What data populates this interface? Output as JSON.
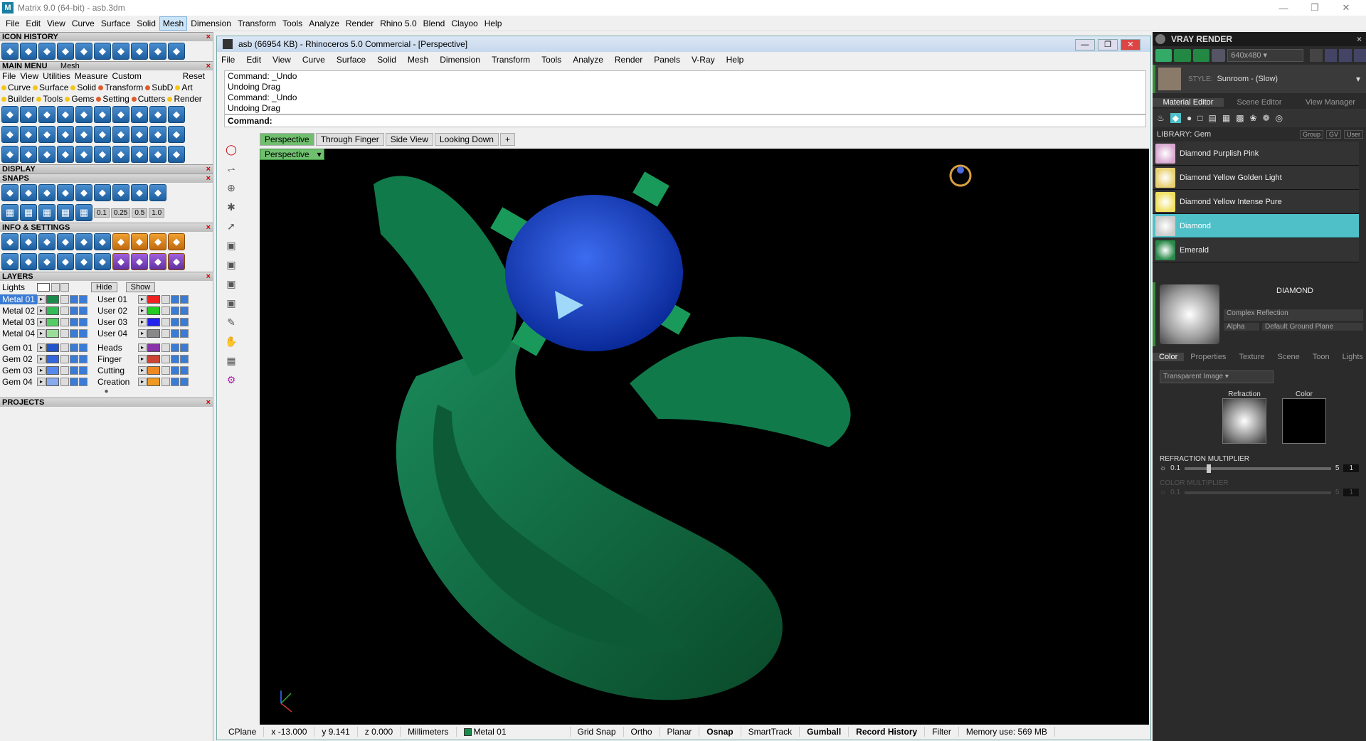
{
  "app": {
    "title": "Matrix 9.0 (64-bit) - asb.3dm"
  },
  "menu": [
    "File",
    "Edit",
    "View",
    "Curve",
    "Surface",
    "Solid",
    "Mesh",
    "Dimension",
    "Transform",
    "Tools",
    "Analyze",
    "Render",
    "Rhino 5.0",
    "Blend",
    "Clayoo",
    "Help"
  ],
  "menu_selected": "Mesh",
  "left": {
    "icon_history": "ICON HISTORY",
    "main_menu": "MAIN MENU",
    "main_menu_sub": "Mesh",
    "mm_row1": [
      "File",
      "View",
      "Utilities",
      "Measure",
      "Custom",
      "Reset"
    ],
    "mm_row2": [
      "Curve",
      "Surface",
      "Solid",
      "Transform",
      "SubD",
      "Art"
    ],
    "mm_row3": [
      "Builder",
      "Tools",
      "Gems",
      "Setting",
      "Cutters",
      "Render"
    ],
    "display": "DISPLAY",
    "snaps": "SNAPS",
    "snap_vals": [
      "0.1",
      "0.25",
      "0.5",
      "1.0"
    ],
    "info": "INFO & SETTINGS",
    "layers": "LAYERS",
    "lights": "Lights",
    "hide": "Hide",
    "show": "Show",
    "layers_left": [
      {
        "n": "Metal 01",
        "c": "#1a8a4a"
      },
      {
        "n": "Metal 02",
        "c": "#33bb55"
      },
      {
        "n": "Metal 03",
        "c": "#55cc66"
      },
      {
        "n": "Metal 04",
        "c": "#99dd99"
      },
      {
        "n": "Gem 01",
        "c": "#2255cc"
      },
      {
        "n": "Gem 02",
        "c": "#3366dd"
      },
      {
        "n": "Gem 03",
        "c": "#5588ee"
      },
      {
        "n": "Gem 04",
        "c": "#88aaee"
      }
    ],
    "layers_right": [
      {
        "n": "User 01",
        "c": "#ee2222"
      },
      {
        "n": "User 02",
        "c": "#22cc22"
      },
      {
        "n": "User 03",
        "c": "#2222ee"
      },
      {
        "n": "User 04",
        "c": "#888888"
      },
      {
        "n": "Heads",
        "c": "#8833aa"
      },
      {
        "n": "Finger",
        "c": "#cc4433"
      },
      {
        "n": "Cutting",
        "c": "#ee8822"
      },
      {
        "n": "Creation",
        "c": "#ee9922"
      }
    ],
    "projects": "PROJECTS"
  },
  "rhino": {
    "title": "asb (66954 KB) - Rhinoceros 5.0 Commercial - [Perspective]",
    "menu": [
      "File",
      "Edit",
      "View",
      "Curve",
      "Surface",
      "Solid",
      "Mesh",
      "Dimension",
      "Transform",
      "Tools",
      "Analyze",
      "Render",
      "Panels",
      "V-Ray",
      "Help"
    ],
    "history": [
      "Command: _Undo",
      "Undoing Drag",
      "Command: _Undo",
      "Undoing Drag"
    ],
    "command_label": "Command:",
    "tabs": [
      "Perspective",
      "Through Finger",
      "Side View",
      "Looking Down"
    ],
    "viewport_label": "Perspective",
    "status": {
      "cplane": "CPlane",
      "x": "x -13.000",
      "y": "y 9.141",
      "z": "z 0.000",
      "units": "Millimeters",
      "layer": "Metal 01",
      "layer_color": "#1a8a4a",
      "grid": "Grid Snap",
      "ortho": "Ortho",
      "planar": "Planar",
      "osnap": "Osnap",
      "smart": "SmartTrack",
      "gumball": "Gumball",
      "record": "Record History",
      "filter": "Filter",
      "memory": "Memory use: 569 MB"
    }
  },
  "vray": {
    "title": "VRAY RENDER",
    "resolution": "640x480",
    "style_label": "STYLE:",
    "style": "Sunroom - (Slow)",
    "tabs": [
      "Material Editor",
      "Scene Editor",
      "View Manager"
    ],
    "library": "LIBRARY: Gem",
    "lib_opts": [
      "Group",
      "GV",
      "User"
    ],
    "materials": [
      {
        "n": "Diamond Purplish Pink",
        "c": "#d8a8d0"
      },
      {
        "n": "Diamond Yellow Golden Light",
        "c": "#e8d070"
      },
      {
        "n": "Diamond Yellow Intense Pure",
        "c": "#f0e060"
      },
      {
        "n": "Diamond",
        "c": "#cccccc",
        "sel": true
      },
      {
        "n": "Emerald",
        "c": "#2a8a4a"
      }
    ],
    "mat_name": "DIAMOND",
    "reflection": "Complex Reflection",
    "alpha": "Alpha",
    "ground": "Default Ground Plane",
    "sub_tabs": [
      "Color",
      "Properties",
      "Texture",
      "Scene",
      "Toon",
      "Lights"
    ],
    "transparent": "Transparent Image",
    "refraction_label": "Refraction",
    "color_label": "Color",
    "refr_mult": "REFRACTION MULTIPLIER",
    "refr_min": "0.1",
    "refr_max": "5",
    "refr_val": "1",
    "color_mult": "COLOR MULTIPLIER",
    "col_min": "0.1",
    "col_max": "5",
    "col_val": "1"
  }
}
